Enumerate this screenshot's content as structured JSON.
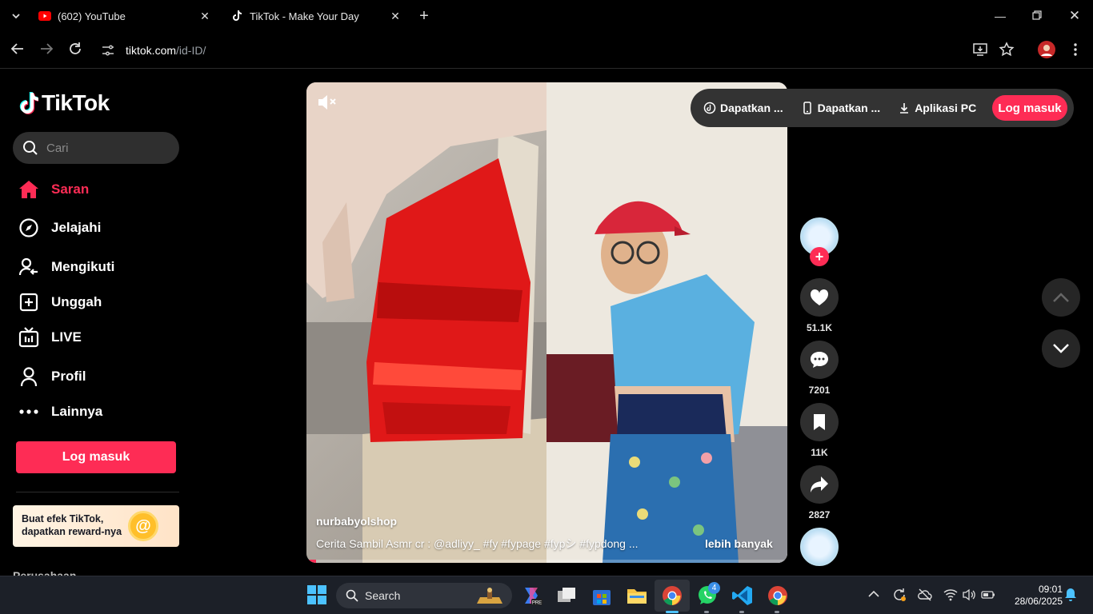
{
  "browser": {
    "tabs": [
      {
        "title": "(602) YouTube",
        "icon": "youtube-icon",
        "active": false
      },
      {
        "title": "TikTok - Make Your Day",
        "icon": "tiktok-icon",
        "active": true
      }
    ],
    "url_host": "tiktok.com",
    "url_path": "/id-ID/"
  },
  "sidebar": {
    "brand": "TikTok",
    "search_placeholder": "Cari",
    "nav": [
      {
        "label": "Saran",
        "icon": "home-icon",
        "active": true
      },
      {
        "label": "Jelajahi",
        "icon": "compass-icon",
        "active": false
      },
      {
        "label": "Mengikuti",
        "icon": "following-icon",
        "active": false
      },
      {
        "label": "Unggah",
        "icon": "upload-icon",
        "active": false
      },
      {
        "label": "LIVE",
        "icon": "live-icon",
        "active": false
      },
      {
        "label": "Profil",
        "icon": "profile-icon",
        "active": false
      },
      {
        "label": "Lainnya",
        "icon": "more-icon",
        "active": false
      }
    ],
    "login_label": "Log masuk",
    "promo_line1": "Buat efek TikTok,",
    "promo_line2": "dapatkan reward-nya",
    "cut_off_heading": "Perusahaan"
  },
  "topbar": {
    "items": [
      {
        "label": "Dapatkan ...",
        "icon": "coin-icon"
      },
      {
        "label": "Dapatkan ...",
        "icon": "phone-icon"
      },
      {
        "label": "Aplikasi PC",
        "icon": "download-icon"
      }
    ],
    "login_label": "Log masuk"
  },
  "video": {
    "username": "nurbabyolshop",
    "description": "Cerita Sambil Asmr cr : @adliyy_ #fy  #fypage  #fypシ  #fypdong  ...",
    "more_label": "lebih banyak",
    "progress": 0.02,
    "muted": true
  },
  "actions": {
    "likes": "51.1K",
    "comments": "7201",
    "saves": "11K",
    "shares": "2827"
  },
  "taskbar": {
    "search_label": "Search",
    "whatsapp_badge": "4",
    "time": "09:01",
    "date": "28/06/2025"
  },
  "colors": {
    "accent": "#fe2c55",
    "background": "#000000",
    "taskbar": "#1c2028"
  }
}
